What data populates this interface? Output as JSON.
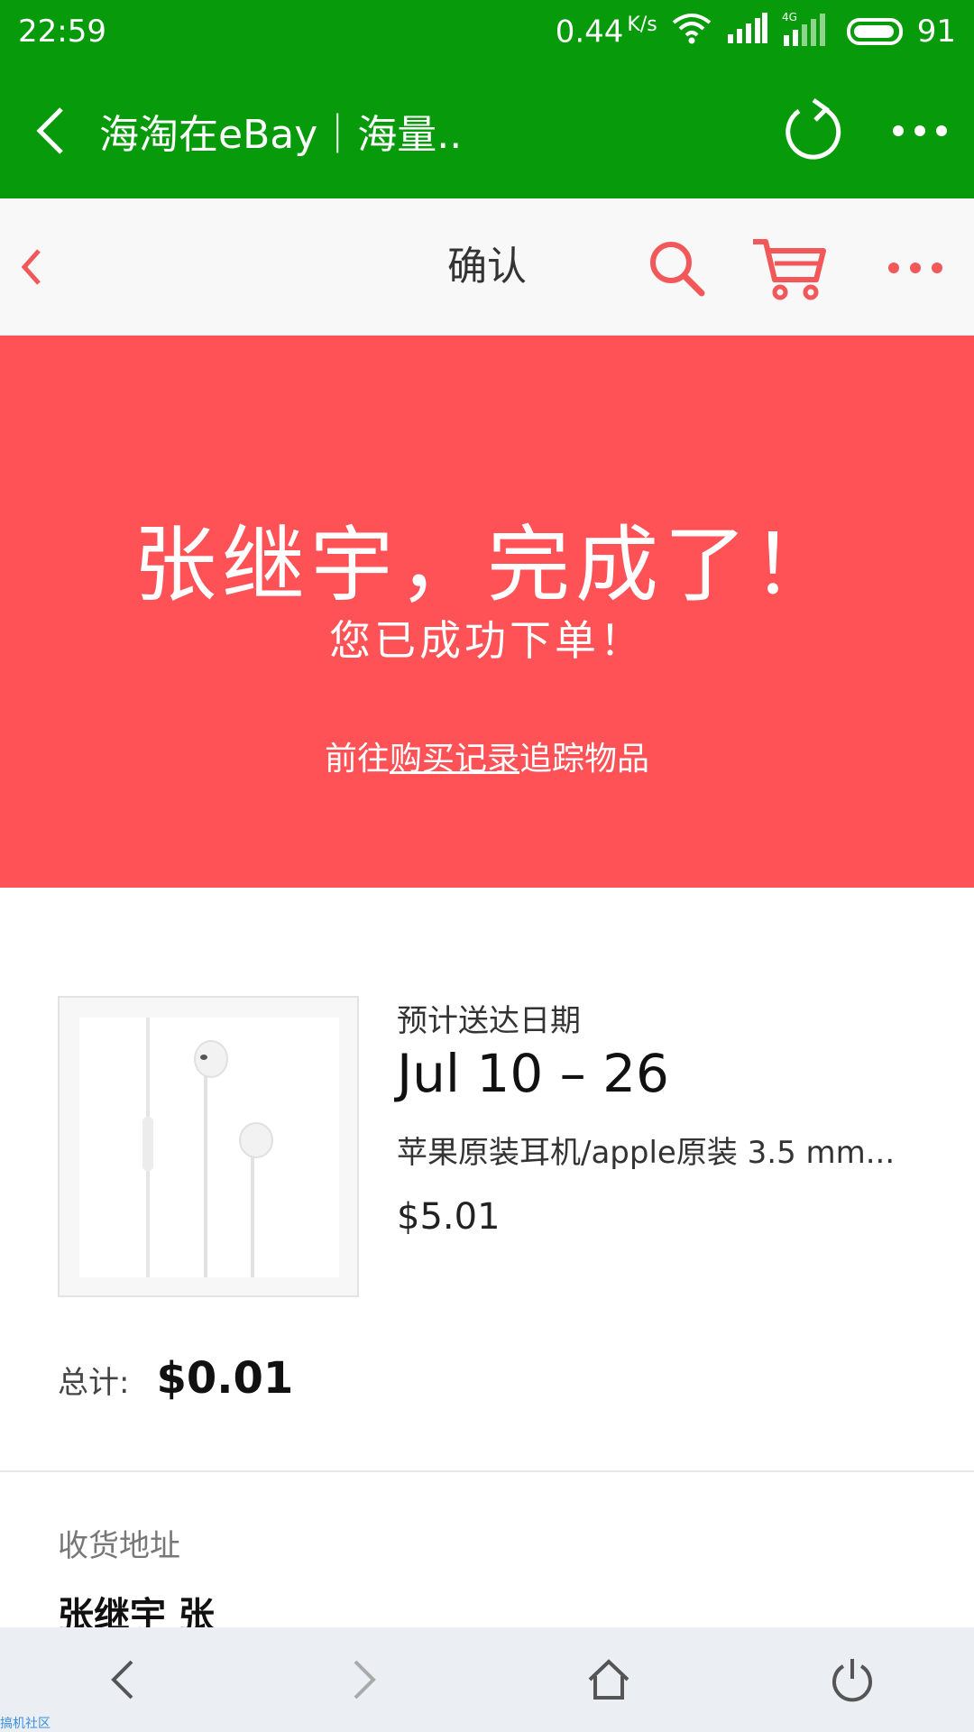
{
  "status_bar": {
    "time": "22:59",
    "speed": "0.44",
    "speed_unit": "K/s",
    "network": "4G",
    "battery": "91"
  },
  "browser": {
    "title": "海淘在eBay｜海量..",
    "icons": [
      "back-icon",
      "refresh-icon",
      "more-icon"
    ]
  },
  "site_header": {
    "title": "确认",
    "accent_color": "#f25859",
    "icons": [
      "back-icon",
      "search-icon",
      "cart-icon",
      "more-icon"
    ]
  },
  "banner": {
    "headline": "张继宇，完成了！",
    "subtext": "您已成功下单！",
    "track_prefix": "前往",
    "track_link": "购买记录",
    "track_suffix": "追踪物品",
    "background": "#ff5257"
  },
  "order": {
    "eta_label": "预计送达日期",
    "eta": "Jul 10 – 26",
    "item_name": "苹果原装耳机/apple原装 3.5 mm...",
    "item_price": "$5.01",
    "total_label": "总计:",
    "total_value": "$0.01"
  },
  "shipping": {
    "label": "收货地址",
    "name": "张继宇 张"
  },
  "bottom_nav": {
    "icons": [
      "back-icon",
      "forward-icon",
      "home-icon",
      "power-icon"
    ]
  },
  "watermark": "搞机社区"
}
